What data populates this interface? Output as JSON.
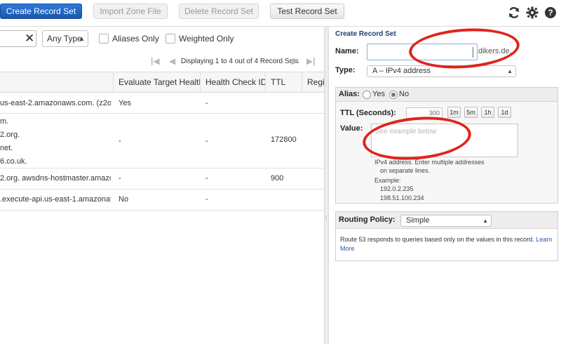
{
  "toolbar": {
    "create_record_set": "Create Record Set",
    "import_zone_file": "Import Zone File",
    "delete_record_set": "Delete Record Set",
    "test_record_set": "Test Record Set",
    "icons": [
      "refresh-icon",
      "gear-icon",
      "help-icon"
    ]
  },
  "filters": {
    "search_value": "",
    "clear_glyph": "✕",
    "type_select": "Any Type",
    "aliases_only": "Aliases Only",
    "weighted_only": "Weighted Only"
  },
  "pager": {
    "text": "Displaying 1 to 4 out of 4 Record Sets"
  },
  "table": {
    "columns": [
      "Evaluate Target Health",
      "Health Check ID",
      "TTL",
      "Regi"
    ],
    "rows": [
      {
        "value": [
          "us-east-2.amazonaws.com. (z2o1"
        ],
        "evaluate": "Yes",
        "health_check": "-",
        "ttl": ""
      },
      {
        "value": [
          "m.",
          "2.org.",
          "net.",
          "6.co.uk."
        ],
        "evaluate": "-",
        "health_check": "-",
        "ttl": "172800"
      },
      {
        "value": [
          "2.org. awsdns-hostmaster.amazo"
        ],
        "evaluate": "-",
        "health_check": "-",
        "ttl": "900"
      },
      {
        "value": [
          ".execute-api.us-east-1.amazonav"
        ],
        "evaluate": "No",
        "health_check": "-",
        "ttl": ""
      }
    ]
  },
  "panel": {
    "title": "Create Record Set",
    "name_label": "Name:",
    "name_value": "",
    "name_suffix": "dikers.de.",
    "type_label": "Type:",
    "type_value": "A – IPv4 address",
    "alias_label": "Alias:",
    "alias_yes": "Yes",
    "alias_no": "No",
    "alias_selected": "No",
    "ttl_label": "TTL (Seconds):",
    "ttl_value": "300",
    "ttl_buttons": [
      "1m",
      "5m",
      "1h",
      "1d"
    ],
    "value_label": "Value:",
    "value_placeholder": "See example below",
    "help_lines": [
      "IPv4 address. Enter multiple addresses",
      "on separate lines.",
      "Example:",
      "192.0.2.235",
      "198.51.100.234"
    ],
    "routing_label": "Routing Policy:",
    "routing_value": "Simple",
    "routing_desc": "Route 53 responds to queries based only on the values in this record.",
    "learn_more": "Learn More"
  },
  "colors": {
    "primary_button": "#1857b0",
    "annotation_red": "#e0241c",
    "panel_title": "#1d3f6e",
    "link": "#1e5cb3"
  }
}
